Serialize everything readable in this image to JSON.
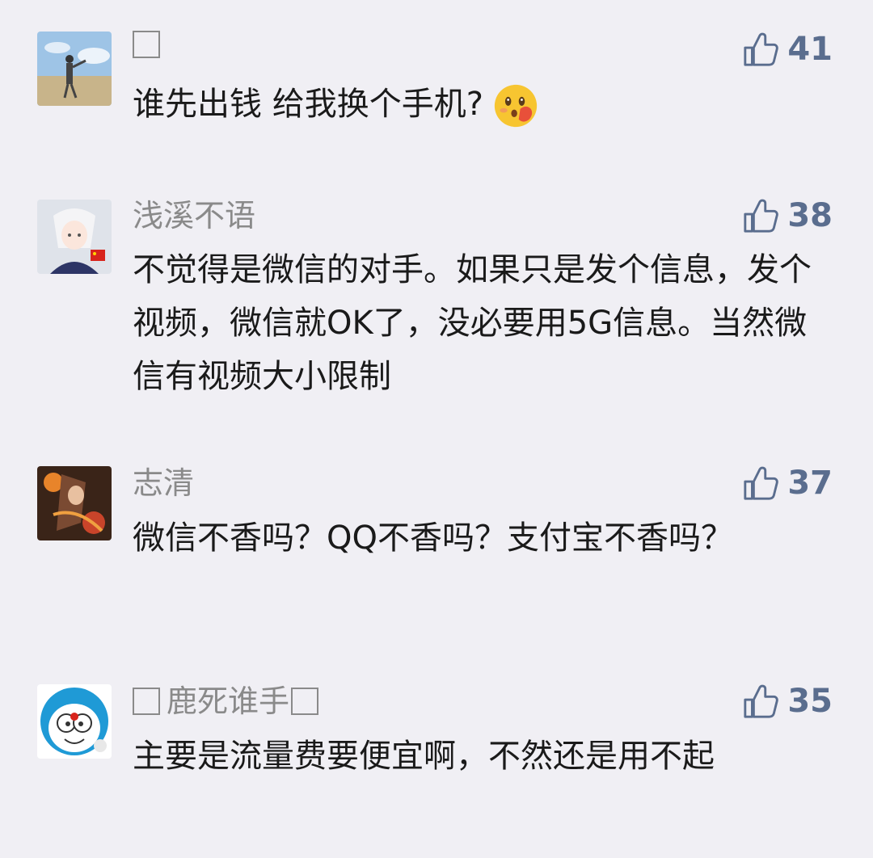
{
  "comments": [
    {
      "username": "",
      "username_prefix_box": true,
      "username_suffix_box": false,
      "likes": "41",
      "text": "谁先出钱  给我换个手机?",
      "emoji": "flushed-face-with-hand"
    },
    {
      "username": "浅溪不语",
      "username_prefix_box": false,
      "username_suffix_box": false,
      "likes": "38",
      "text": "不觉得是微信的对手。如果只是发个信息，发个视频，微信就OK了，没必要用5G信息。当然微信有视频大小限制"
    },
    {
      "username": "志清",
      "username_prefix_box": false,
      "username_suffix_box": false,
      "likes": "37",
      "text": "微信不香吗？QQ不香吗？支付宝不香吗？"
    },
    {
      "username": "鹿死谁手",
      "username_prefix_box": true,
      "username_suffix_box": true,
      "likes": "35",
      "text": "主要是流量费要便宜啊，不然还是用不起"
    }
  ],
  "colors": {
    "background": "#f0eff4",
    "like": "#5a6d8e",
    "username": "#8a8a8a",
    "text": "#1a1a1a"
  },
  "icons": [
    "thumbs-up-icon",
    "avatar",
    "emoji"
  ]
}
